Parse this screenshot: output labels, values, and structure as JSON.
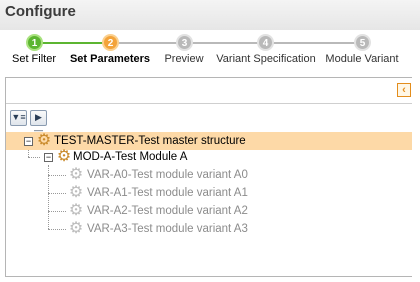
{
  "header": {
    "title": "Configure"
  },
  "wizard": {
    "steps": [
      {
        "number": "1",
        "label": "Set Filter",
        "state": "done",
        "color": "#5cb531"
      },
      {
        "number": "2",
        "label": "Set Parameters",
        "state": "current",
        "color": "#f3a33a"
      },
      {
        "number": "3",
        "label": "Preview",
        "state": "pending",
        "color": "#b9b9b9"
      },
      {
        "number": "4",
        "label": "Variant Specification",
        "state": "pending",
        "color": "#b9b9b9"
      },
      {
        "number": "5",
        "label": "Module Variant",
        "state": "pending",
        "color": "#b9b9b9"
      }
    ]
  },
  "panel": {
    "collapse_icon": "collapse-left-icon"
  },
  "toolbar": {
    "buttons": [
      "expand-all-icon",
      "collapse-all-icon"
    ]
  },
  "tree": {
    "root": {
      "label": "TEST-MASTER-Test master structure",
      "expanded": true,
      "selected": true
    },
    "module": {
      "label": "MOD-A-Test Module A",
      "expanded": true
    },
    "variants": [
      {
        "label": "VAR-A0-Test module variant A0"
      },
      {
        "label": "VAR-A1-Test module variant A1"
      },
      {
        "label": "VAR-A2-Test module variant A2"
      },
      {
        "label": "VAR-A3-Test module variant A3"
      }
    ]
  },
  "colors": {
    "selected_row": "#fdd9a7",
    "accent": "#e38d1c",
    "muted_text": "#8c8c8c"
  }
}
